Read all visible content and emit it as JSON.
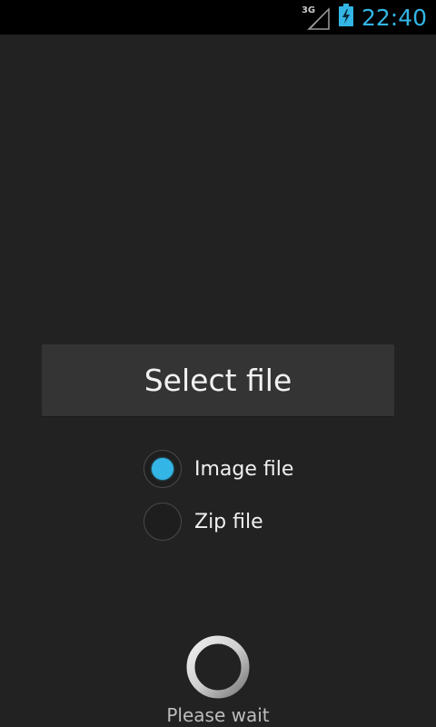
{
  "status_bar": {
    "network_type": "3G",
    "time": "22:40",
    "icons": [
      "signal-icon",
      "battery-charging-icon"
    ],
    "accent_color": "#33b5e5"
  },
  "main": {
    "select_button_label": "Select file",
    "file_type_options": [
      {
        "label": "Image file",
        "selected": true
      },
      {
        "label": "Zip file",
        "selected": false
      }
    ],
    "loading_text": "Please wait"
  }
}
